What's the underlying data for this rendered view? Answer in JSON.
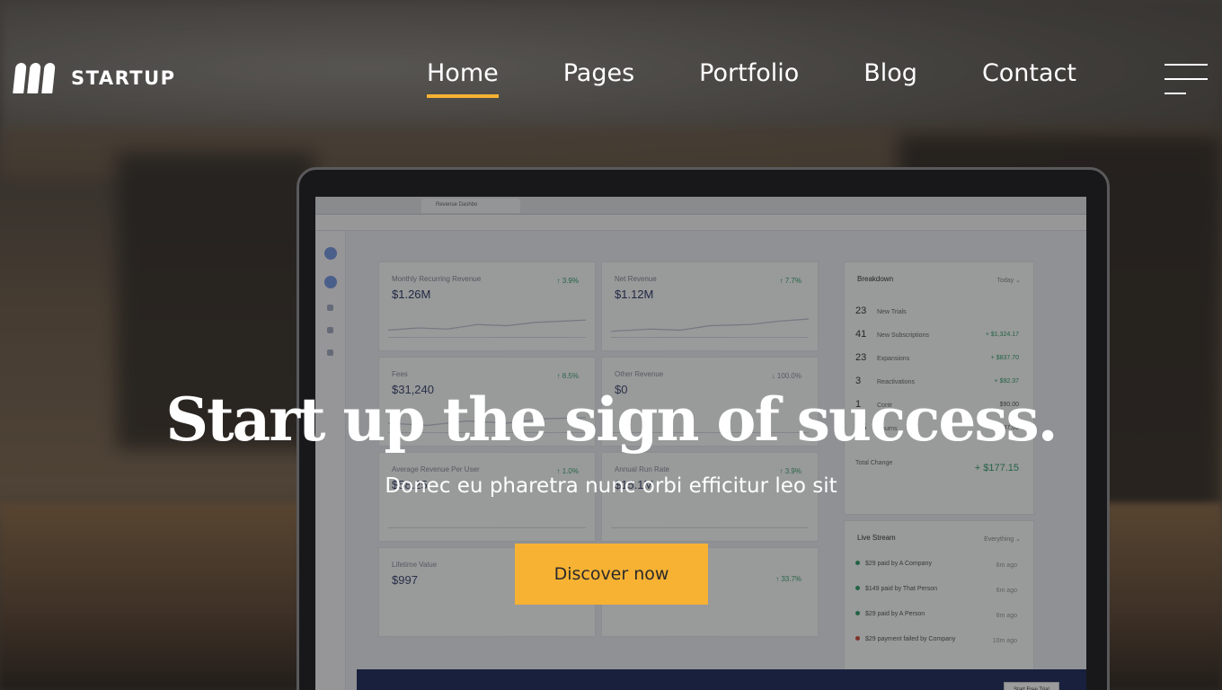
{
  "brand": {
    "name": "STARTUP"
  },
  "nav": {
    "items": [
      {
        "label": "Home",
        "active": true
      },
      {
        "label": "Pages"
      },
      {
        "label": "Portfolio"
      },
      {
        "label": "Blog"
      },
      {
        "label": "Contact"
      }
    ],
    "menu_icon": "hamburger-menu-icon",
    "active_color": "#f7b233"
  },
  "hero": {
    "title": "Start up the sign of success.",
    "subtitle": "Donec eu pharetra nunc orbi efficitur leo sit",
    "cta_label": "Discover now",
    "cta_color": "#f7b233"
  },
  "background_dashboard": {
    "tab_title": "Revenue Dashbo",
    "cards": [
      {
        "label": "Monthly Recurring Revenue",
        "value": "$1.26M",
        "change": "↑ 3.9%"
      },
      {
        "label": "Net Revenue",
        "value": "$1.12M",
        "change": "↑ 7.7%"
      },
      {
        "label": "Fees",
        "value": "$31,240",
        "change": "↑ 8.5%"
      },
      {
        "label": "Other Revenue",
        "value": "$0",
        "change": "↓ 100.0%"
      },
      {
        "label": "Average Revenue Per User",
        "value": "$58.25",
        "change": "↑ 1.0%"
      },
      {
        "label": "Annual Run Rate",
        "value": "$15.1M",
        "change": "↑ 3.9%"
      },
      {
        "label": "Lifetime Value",
        "value": "$997",
        "change": ""
      },
      {
        "label": "",
        "value": "",
        "change": "↑ 33.7%"
      }
    ],
    "breakdown": {
      "title": "Breakdown",
      "filter": "Today ⌄",
      "rows": [
        {
          "count": "23",
          "label": "New Trials",
          "amount": ""
        },
        {
          "count": "41",
          "label": "New Subscriptions",
          "amount": "+ $1,324.17"
        },
        {
          "count": "23",
          "label": "Expansions",
          "amount": "+ $837.70"
        },
        {
          "count": "3",
          "label": "Reactivations",
          "amount": "+ $92.37"
        },
        {
          "count": "1",
          "label": "Contr",
          "amount": "$90.00"
        },
        {
          "count": "45",
          "label": "Churns",
          "amount": "$1,987.09"
        }
      ],
      "total_label": "Total Change",
      "total_value": "+ $177.15"
    },
    "live_stream": {
      "title": "Live Stream",
      "filter": "Everything ⌄",
      "items": [
        {
          "text": "$29 paid by A Company",
          "ago": "6m ago",
          "status": "ok"
        },
        {
          "text": "$149 paid by That Person",
          "ago": "6m ago",
          "status": "ok"
        },
        {
          "text": "$29 paid by A Person",
          "ago": "8m ago",
          "status": "ok"
        },
        {
          "text": "$29 payment failed by Company",
          "ago": "10m ago",
          "status": "fail"
        }
      ]
    },
    "trial_button": "Start Free Trial"
  }
}
